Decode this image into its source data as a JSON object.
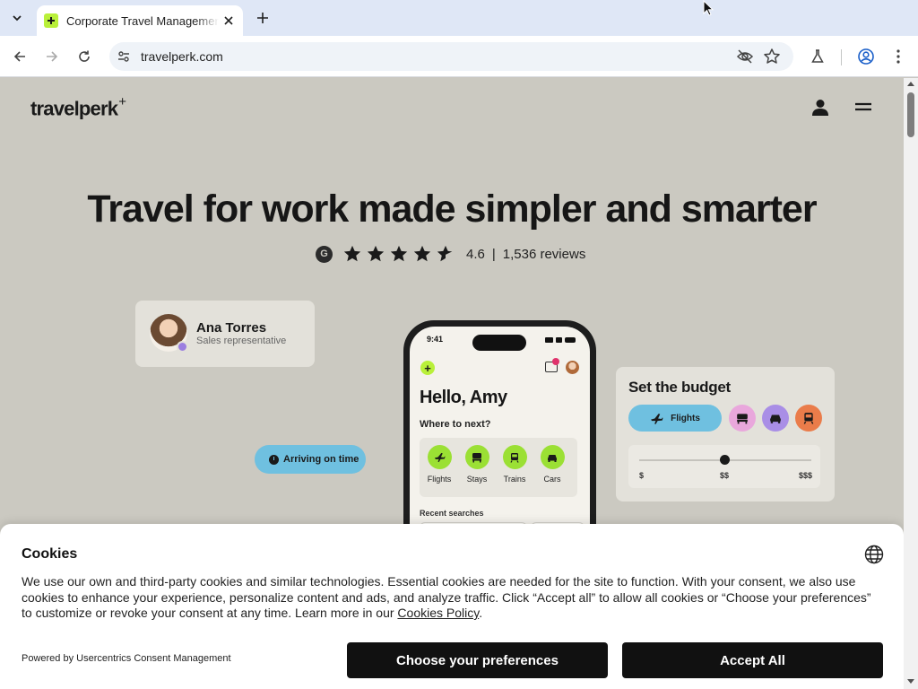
{
  "browser": {
    "tab_title": "Corporate Travel Management Software",
    "url": "travelperk.com"
  },
  "page": {
    "logo": "travelperk",
    "logo_mark": "+",
    "hero_title": "Travel for work made simpler and smarter",
    "rating": {
      "badge": "G",
      "score": "4.6",
      "separator": "|",
      "reviews": "1,536 reviews",
      "stars_value": 4.6,
      "stars_max": 5
    },
    "profile_card": {
      "name": "Ana Torres",
      "role": "Sales representative"
    },
    "arriving_pill": "Arriving on time",
    "phone": {
      "time": "9:41",
      "notification_count": "0",
      "greeting": "Hello, Amy",
      "where_label": "Where to next?",
      "categories": [
        {
          "label": "Flights",
          "icon": "plane-icon"
        },
        {
          "label": "Stays",
          "icon": "bed-icon"
        },
        {
          "label": "Trains",
          "icon": "train-icon"
        },
        {
          "label": "Cars",
          "icon": "car-icon"
        }
      ],
      "recent_label": "Recent searches"
    },
    "budget_card": {
      "title": "Set the budget",
      "flights_label": "Flights",
      "options": [
        {
          "icon": "bed-icon",
          "color": "#e9a7dc"
        },
        {
          "icon": "car-icon",
          "color": "#a98ee6"
        },
        {
          "icon": "train-icon",
          "color": "#ea7c4a"
        }
      ],
      "slider_labels": [
        "$",
        "$$",
        "$$$"
      ],
      "slider_value": "$$"
    }
  },
  "cookie_banner": {
    "title": "Cookies",
    "body": "We use our own and third-party cookies and similar technologies. Essential cookies are needed for the site to function. With your consent, we also use cookies to enhance your experience, personalize content and ads, and analyze traffic. Click “Accept all” to allow all cookies or “Choose your preferences” to customize or revoke your consent at any time. Learn more in our ",
    "policy_link": "Cookies Policy",
    "body_end": ".",
    "powered_by": "Powered by Usercentrics Consent Management",
    "choose_button": "Choose your preferences",
    "accept_button": "Accept All"
  },
  "colors": {
    "page_bg": "#cbc9c1",
    "accent_green": "#b9f03a",
    "accent_blue": "#6fc0e0",
    "button_dark": "#111111"
  }
}
